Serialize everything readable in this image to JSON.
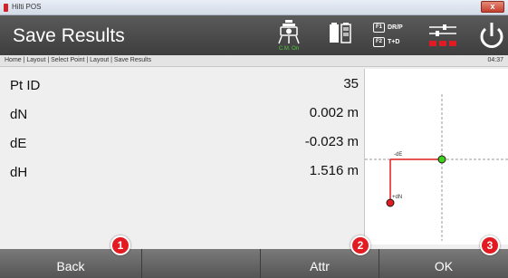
{
  "window": {
    "title": "Hilti POS",
    "close_glyph": "x"
  },
  "header": {
    "title": "Save Results",
    "status_label": "C.M. On",
    "f1_key": "F1",
    "f1_label": "DR/P",
    "f2_key": "F2",
    "f2_label": "T+D"
  },
  "breadcrumb": "Home | Layout | Select Point | Layout | Save Results",
  "clock": "04:37",
  "results": [
    {
      "label": "Pt ID",
      "value": "35"
    },
    {
      "label": "dN",
      "value": "0.002 m"
    },
    {
      "label": "dE",
      "value": "-0.023 m"
    },
    {
      "label": "dH",
      "value": "1.516 m"
    }
  ],
  "graphic": {
    "de_label": "-dE",
    "dn_label": "+dN"
  },
  "footer": {
    "back": "Back",
    "attr": "Attr",
    "ok": "OK"
  },
  "markers": [
    "1",
    "2",
    "3"
  ],
  "colors": {
    "accent_red": "#e21b23",
    "header_bg": "#4a4a4a",
    "status_green": "#4ecb3a"
  }
}
